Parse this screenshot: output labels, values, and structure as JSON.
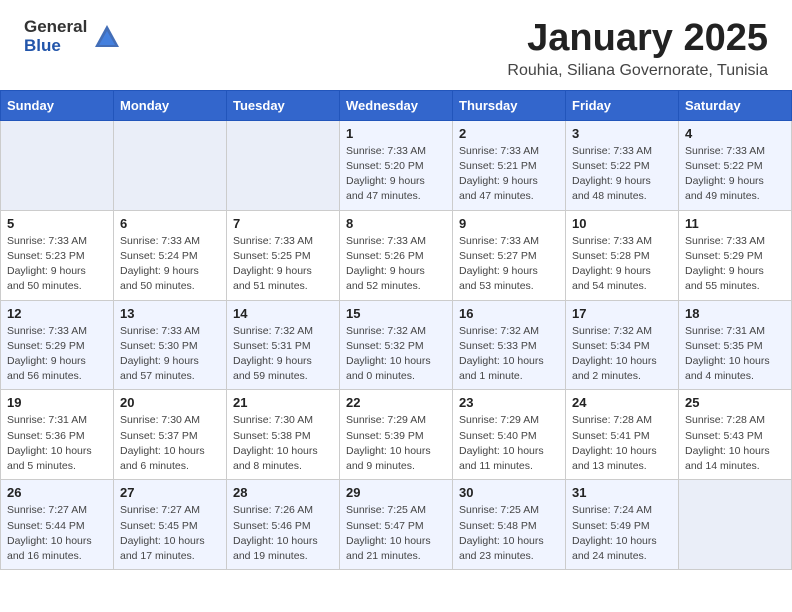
{
  "header": {
    "logo_general": "General",
    "logo_blue": "Blue",
    "month_title": "January 2025",
    "location": "Rouhia, Siliana Governorate, Tunisia"
  },
  "days_of_week": [
    "Sunday",
    "Monday",
    "Tuesday",
    "Wednesday",
    "Thursday",
    "Friday",
    "Saturday"
  ],
  "weeks": [
    [
      {
        "day": "",
        "info": ""
      },
      {
        "day": "",
        "info": ""
      },
      {
        "day": "",
        "info": ""
      },
      {
        "day": "1",
        "info": "Sunrise: 7:33 AM\nSunset: 5:20 PM\nDaylight: 9 hours\nand 47 minutes."
      },
      {
        "day": "2",
        "info": "Sunrise: 7:33 AM\nSunset: 5:21 PM\nDaylight: 9 hours\nand 47 minutes."
      },
      {
        "day": "3",
        "info": "Sunrise: 7:33 AM\nSunset: 5:22 PM\nDaylight: 9 hours\nand 48 minutes."
      },
      {
        "day": "4",
        "info": "Sunrise: 7:33 AM\nSunset: 5:22 PM\nDaylight: 9 hours\nand 49 minutes."
      }
    ],
    [
      {
        "day": "5",
        "info": "Sunrise: 7:33 AM\nSunset: 5:23 PM\nDaylight: 9 hours\nand 50 minutes."
      },
      {
        "day": "6",
        "info": "Sunrise: 7:33 AM\nSunset: 5:24 PM\nDaylight: 9 hours\nand 50 minutes."
      },
      {
        "day": "7",
        "info": "Sunrise: 7:33 AM\nSunset: 5:25 PM\nDaylight: 9 hours\nand 51 minutes."
      },
      {
        "day": "8",
        "info": "Sunrise: 7:33 AM\nSunset: 5:26 PM\nDaylight: 9 hours\nand 52 minutes."
      },
      {
        "day": "9",
        "info": "Sunrise: 7:33 AM\nSunset: 5:27 PM\nDaylight: 9 hours\nand 53 minutes."
      },
      {
        "day": "10",
        "info": "Sunrise: 7:33 AM\nSunset: 5:28 PM\nDaylight: 9 hours\nand 54 minutes."
      },
      {
        "day": "11",
        "info": "Sunrise: 7:33 AM\nSunset: 5:29 PM\nDaylight: 9 hours\nand 55 minutes."
      }
    ],
    [
      {
        "day": "12",
        "info": "Sunrise: 7:33 AM\nSunset: 5:29 PM\nDaylight: 9 hours\nand 56 minutes."
      },
      {
        "day": "13",
        "info": "Sunrise: 7:33 AM\nSunset: 5:30 PM\nDaylight: 9 hours\nand 57 minutes."
      },
      {
        "day": "14",
        "info": "Sunrise: 7:32 AM\nSunset: 5:31 PM\nDaylight: 9 hours\nand 59 minutes."
      },
      {
        "day": "15",
        "info": "Sunrise: 7:32 AM\nSunset: 5:32 PM\nDaylight: 10 hours\nand 0 minutes."
      },
      {
        "day": "16",
        "info": "Sunrise: 7:32 AM\nSunset: 5:33 PM\nDaylight: 10 hours\nand 1 minute."
      },
      {
        "day": "17",
        "info": "Sunrise: 7:32 AM\nSunset: 5:34 PM\nDaylight: 10 hours\nand 2 minutes."
      },
      {
        "day": "18",
        "info": "Sunrise: 7:31 AM\nSunset: 5:35 PM\nDaylight: 10 hours\nand 4 minutes."
      }
    ],
    [
      {
        "day": "19",
        "info": "Sunrise: 7:31 AM\nSunset: 5:36 PM\nDaylight: 10 hours\nand 5 minutes."
      },
      {
        "day": "20",
        "info": "Sunrise: 7:30 AM\nSunset: 5:37 PM\nDaylight: 10 hours\nand 6 minutes."
      },
      {
        "day": "21",
        "info": "Sunrise: 7:30 AM\nSunset: 5:38 PM\nDaylight: 10 hours\nand 8 minutes."
      },
      {
        "day": "22",
        "info": "Sunrise: 7:29 AM\nSunset: 5:39 PM\nDaylight: 10 hours\nand 9 minutes."
      },
      {
        "day": "23",
        "info": "Sunrise: 7:29 AM\nSunset: 5:40 PM\nDaylight: 10 hours\nand 11 minutes."
      },
      {
        "day": "24",
        "info": "Sunrise: 7:28 AM\nSunset: 5:41 PM\nDaylight: 10 hours\nand 13 minutes."
      },
      {
        "day": "25",
        "info": "Sunrise: 7:28 AM\nSunset: 5:43 PM\nDaylight: 10 hours\nand 14 minutes."
      }
    ],
    [
      {
        "day": "26",
        "info": "Sunrise: 7:27 AM\nSunset: 5:44 PM\nDaylight: 10 hours\nand 16 minutes."
      },
      {
        "day": "27",
        "info": "Sunrise: 7:27 AM\nSunset: 5:45 PM\nDaylight: 10 hours\nand 17 minutes."
      },
      {
        "day": "28",
        "info": "Sunrise: 7:26 AM\nSunset: 5:46 PM\nDaylight: 10 hours\nand 19 minutes."
      },
      {
        "day": "29",
        "info": "Sunrise: 7:25 AM\nSunset: 5:47 PM\nDaylight: 10 hours\nand 21 minutes."
      },
      {
        "day": "30",
        "info": "Sunrise: 7:25 AM\nSunset: 5:48 PM\nDaylight: 10 hours\nand 23 minutes."
      },
      {
        "day": "31",
        "info": "Sunrise: 7:24 AM\nSunset: 5:49 PM\nDaylight: 10 hours\nand 24 minutes."
      },
      {
        "day": "",
        "info": ""
      }
    ]
  ]
}
